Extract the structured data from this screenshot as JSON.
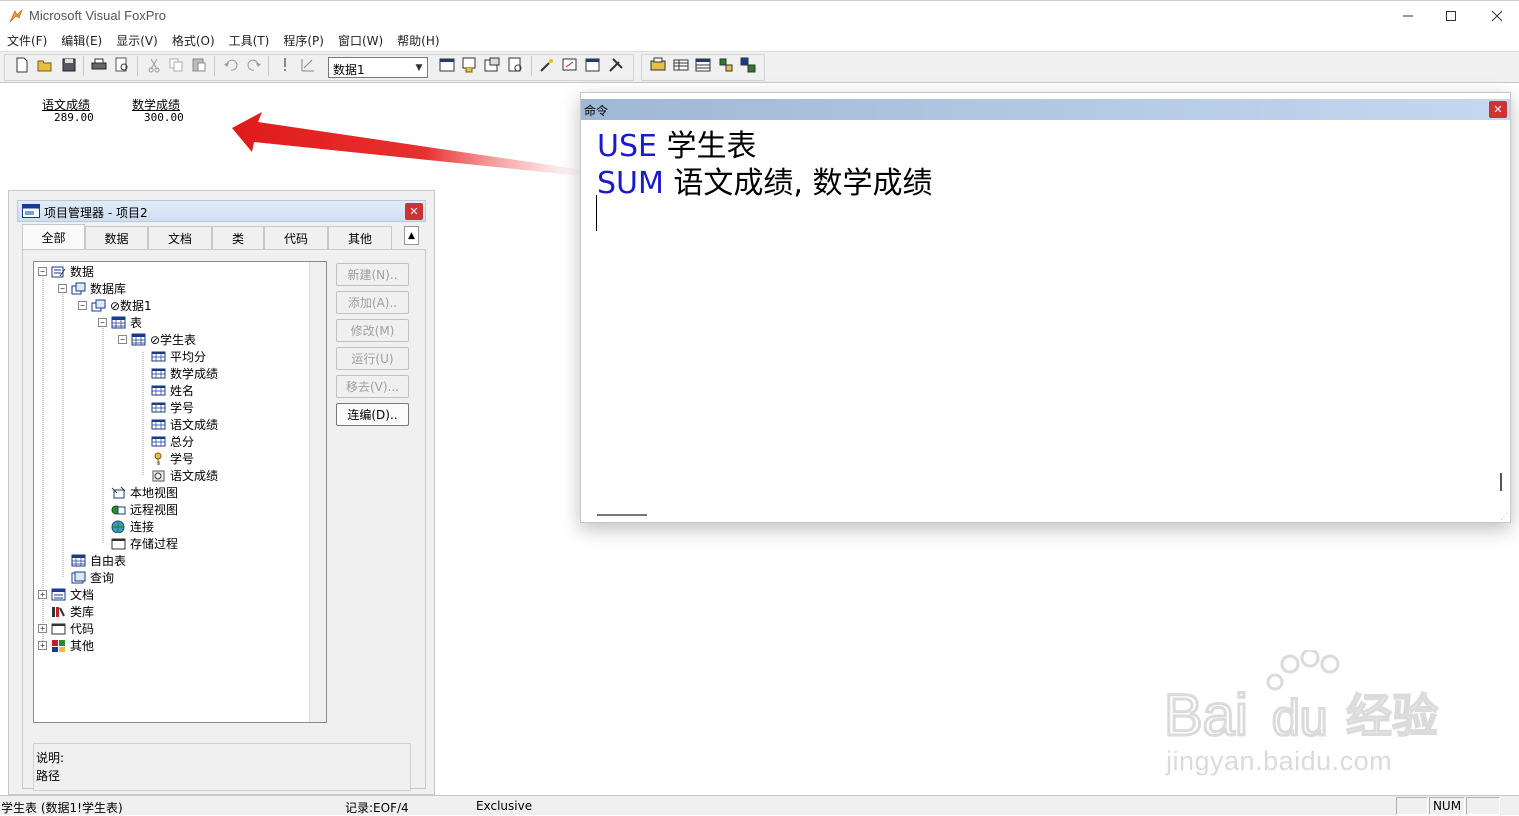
{
  "window": {
    "title": "Microsoft Visual FoxPro"
  },
  "menu": [
    "文件(F)",
    "编辑(E)",
    "显示(V)",
    "格式(O)",
    "工具(T)",
    "程序(P)",
    "窗口(W)",
    "帮助(H)"
  ],
  "toolbar": {
    "database_combo_value": "数据1"
  },
  "output": {
    "fields": [
      {
        "label": "语文成绩",
        "value": "289.00"
      },
      {
        "label": "数学成绩",
        "value": "300.00"
      }
    ]
  },
  "project_manager": {
    "title": "项目管理器 - 项目2",
    "tabs": [
      "全部",
      "数据",
      "文档",
      "类",
      "代码",
      "其他"
    ],
    "active_tab": "全部",
    "tree": [
      {
        "label": "数据",
        "icon": "data-icon",
        "expander": "−"
      },
      {
        "label": "数据库",
        "icon": "database-icon",
        "expander": "−"
      },
      {
        "label": "⊘数据1",
        "icon": "database-icon",
        "expander": "−"
      },
      {
        "label": "表",
        "icon": "table-icon",
        "expander": "−"
      },
      {
        "label": "⊘学生表",
        "icon": "table-icon",
        "expander": "−"
      },
      {
        "label": "平均分",
        "icon": "field-icon",
        "expander": ""
      },
      {
        "label": "数学成绩",
        "icon": "field-icon",
        "expander": ""
      },
      {
        "label": "姓名",
        "icon": "field-icon",
        "expander": ""
      },
      {
        "label": "学号",
        "icon": "field-icon",
        "expander": ""
      },
      {
        "label": "语文成绩",
        "icon": "field-icon",
        "expander": ""
      },
      {
        "label": "总分",
        "icon": "field-icon",
        "expander": ""
      },
      {
        "label": "学号",
        "icon": "key-icon",
        "expander": ""
      },
      {
        "label": "语文成绩",
        "icon": "index-icon",
        "expander": ""
      },
      {
        "label": "本地视图",
        "icon": "local-view-icon",
        "expander": ""
      },
      {
        "label": "远程视图",
        "icon": "remote-view-icon",
        "expander": ""
      },
      {
        "label": "连接",
        "icon": "connection-icon",
        "expander": ""
      },
      {
        "label": "存储过程",
        "icon": "stored-procedure-icon",
        "expander": ""
      },
      {
        "label": "自由表",
        "icon": "table-icon",
        "expander": ""
      },
      {
        "label": "查询",
        "icon": "query-icon",
        "expander": ""
      },
      {
        "label": "文档",
        "icon": "documents-icon",
        "expander": "+"
      },
      {
        "label": "类库",
        "icon": "class-library-icon",
        "expander": ""
      },
      {
        "label": "代码",
        "icon": "code-icon",
        "expander": "+"
      },
      {
        "label": "其他",
        "icon": "other-icon",
        "expander": "+"
      }
    ],
    "buttons": [
      {
        "label": "新建(N)..",
        "enabled": false
      },
      {
        "label": "添加(A)..",
        "enabled": false
      },
      {
        "label": "修改(M)",
        "enabled": false
      },
      {
        "label": "运行(U)",
        "enabled": false
      },
      {
        "label": "移去(V)...",
        "enabled": false
      },
      {
        "label": "连编(D)..",
        "enabled": true
      }
    ],
    "description_label": "说明:",
    "path_label": "路径"
  },
  "command_window": {
    "title": "命令",
    "lines": [
      {
        "keyword": "USE",
        "rest": " 学生表"
      },
      {
        "keyword": "SUM",
        "rest": " 语文成绩, 数学成绩"
      }
    ]
  },
  "statusbar": {
    "table_info": "学生表 (数据1!学生表)",
    "record": "记录:EOF/4",
    "mode": "Exclusive",
    "num": "NUM"
  },
  "watermark": {
    "text": "jingyan.baidu.com"
  },
  "colors": {
    "keyword": "#1a1acc",
    "accent_red": "#e02020",
    "titlebar_blue": "#9fb8d6"
  }
}
